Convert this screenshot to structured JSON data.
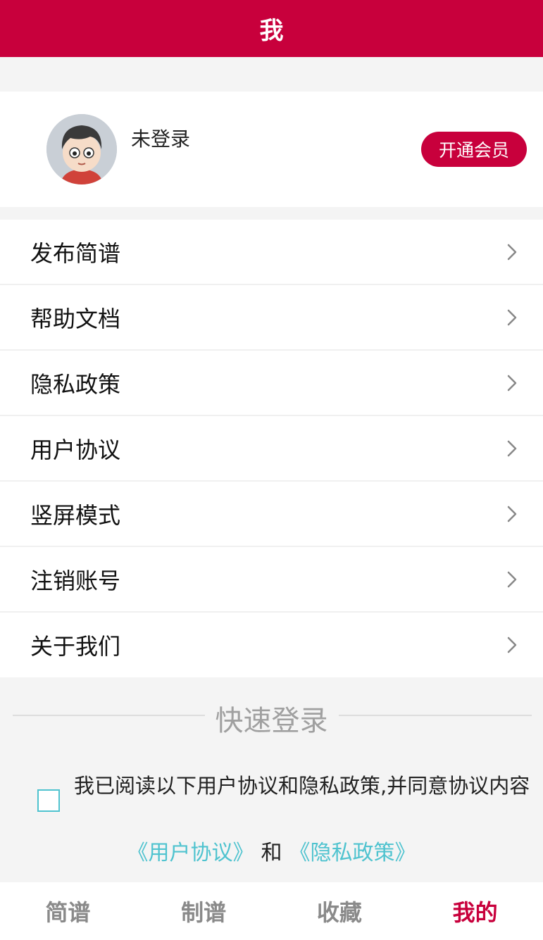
{
  "header": {
    "title": "我"
  },
  "profile": {
    "username": "未登录",
    "vip_button": "开通会员"
  },
  "menu": {
    "items": [
      {
        "label": "发布简谱"
      },
      {
        "label": "帮助文档"
      },
      {
        "label": "隐私政策"
      },
      {
        "label": "用户协议"
      },
      {
        "label": "竖屏模式"
      },
      {
        "label": "注销账号"
      },
      {
        "label": "关于我们"
      }
    ]
  },
  "quick_login": {
    "title": "快速登录",
    "agree_text": "我已阅读以下用户协议和隐私政策,并同意协议内容",
    "checkbox_checked": false,
    "link_user_agreement": "《用户协议》",
    "and_text": "和",
    "link_privacy_policy": "《隐私政策》"
  },
  "tabbar": {
    "tabs": [
      {
        "label": "简谱"
      },
      {
        "label": "制谱"
      },
      {
        "label": "收藏"
      },
      {
        "label": "我的"
      }
    ],
    "active_index": 3
  },
  "colors": {
    "brand": "#c8003c",
    "link": "#4fc3cf",
    "background": "#f4f4f4"
  },
  "icons": {
    "avatar": "cartoon-avatar-icon",
    "menu_arrow": "chevron-right-icon"
  }
}
